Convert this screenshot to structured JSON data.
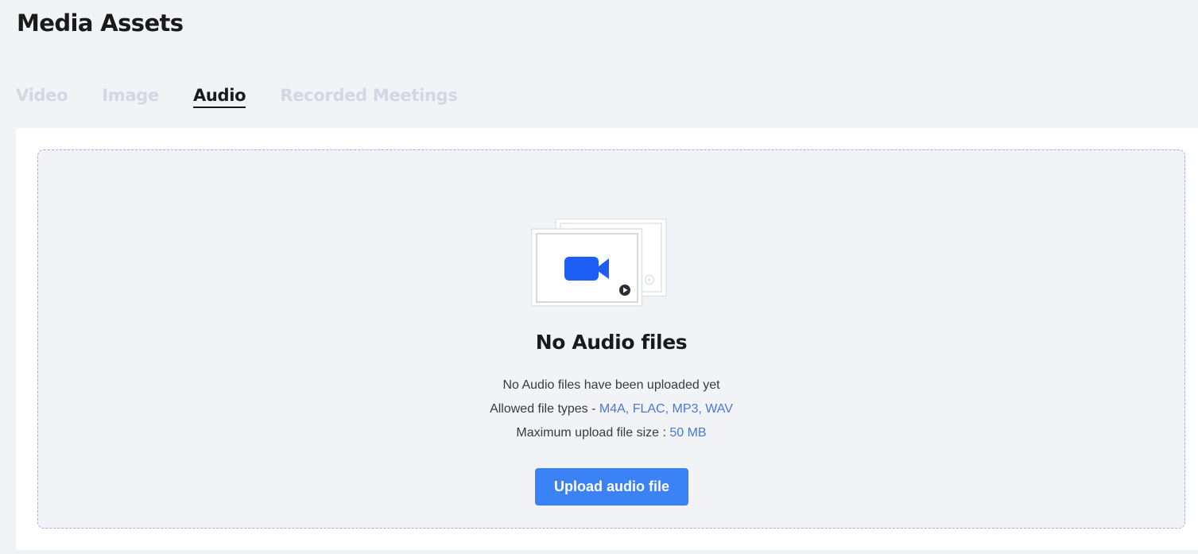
{
  "header": {
    "title": "Media Assets"
  },
  "tabs": [
    {
      "label": "Video",
      "active": false
    },
    {
      "label": "Image",
      "active": false
    },
    {
      "label": "Audio",
      "active": true
    },
    {
      "label": "Recorded Meetings",
      "active": false
    }
  ],
  "empty_state": {
    "icon": "video-camera-icon",
    "title": "No Audio files",
    "message": "No Audio files have been uploaded yet",
    "allowed_types_label": "Allowed file types - ",
    "allowed_types_value": "M4A, FLAC, MP3, WAV",
    "max_size_label": "Maximum upload file size : ",
    "max_size_value": "50 MB",
    "upload_button_label": "Upload audio file"
  },
  "colors": {
    "accent": "#3b82f6",
    "link": "#4a78d6",
    "camera": "#1d5ff5",
    "inactive_tab": "#d3d8e0",
    "background": "#f1f3f7"
  }
}
